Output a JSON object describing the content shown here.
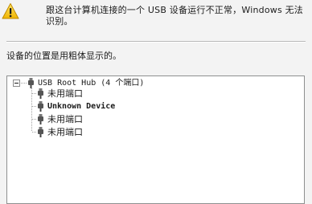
{
  "warning": {
    "icon": "warning-icon",
    "message": "跟这台计算机连接的一个 USB 设备运行不正常，Windows 无法识别。"
  },
  "location_label": "设备的位置是用粗体显示的。",
  "tree": {
    "root": {
      "icon": "usb-connector-icon",
      "label": "USB Root Hub (4 个端口)",
      "expanded": true
    },
    "children": [
      {
        "label": "未用端口",
        "icon": "usb-connector-icon",
        "bold": false
      },
      {
        "label": "Unknown Device",
        "icon": "usb-connector-icon",
        "bold": true
      },
      {
        "label": "未用端口",
        "icon": "usb-connector-icon",
        "bold": false
      },
      {
        "label": "未用端口",
        "icon": "usb-connector-icon",
        "bold": false
      }
    ]
  },
  "colors": {
    "window_bg": "#f3f3f3",
    "tree_bg": "#ffffff",
    "warning_yellow": "#f5c400"
  }
}
